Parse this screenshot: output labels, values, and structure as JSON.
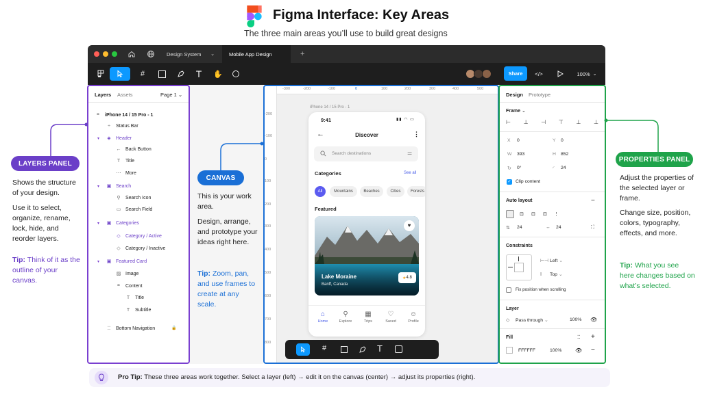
{
  "header": {
    "title": "Figma Interface: Key Areas",
    "subtitle": "The three main areas you’ll use to build great designs"
  },
  "tabs": {
    "design_system": "Design System",
    "mobile_app": "Mobile App Design",
    "new_tab": "+"
  },
  "toolbar": {
    "share": "Share",
    "zoom": "100%"
  },
  "layers_panel": {
    "tab_layers": "Layers",
    "tab_assets": "Assets",
    "page": "Page 1",
    "items": [
      {
        "label": "iPhone 14 / 15 Pro - 1"
      },
      {
        "label": "Status Bar"
      },
      {
        "label": "Header"
      },
      {
        "label": "Back Button"
      },
      {
        "label": "Title"
      },
      {
        "label": "More"
      },
      {
        "label": "Search"
      },
      {
        "label": "Search Icon"
      },
      {
        "label": "Search Field"
      },
      {
        "label": "Categories"
      },
      {
        "label": "Category / Active"
      },
      {
        "label": "Category / Inactive"
      },
      {
        "label": "Featured Card"
      },
      {
        "label": "Image"
      },
      {
        "label": "Content"
      },
      {
        "label": "Title"
      },
      {
        "label": "Subtitle"
      },
      {
        "label": "Bottom Navigation"
      }
    ]
  },
  "canvas": {
    "ruler_x": [
      "-300",
      "-200",
      "-100",
      "0",
      "100",
      "200",
      "300",
      "400",
      "500"
    ],
    "ruler_y": [
      "-200",
      "-100",
      "0",
      "100",
      "200",
      "300",
      "400",
      "500",
      "600",
      "700",
      "800"
    ],
    "frame_label": "iPhone 14 / 15 Pro - 1",
    "phone": {
      "time": "9:41",
      "screen_title": "Discover",
      "search_placeholder": "Search destinations",
      "categories_title": "Categories",
      "see_all": "See all",
      "chips": [
        "All",
        "Mountains",
        "Beaches",
        "Cities",
        "Forests"
      ],
      "featured_title": "Featured",
      "card_title": "Lake Moraine",
      "card_subtitle": "Banff, Canada",
      "rating": "4.8",
      "nav": [
        "Home",
        "Explore",
        "Trips",
        "Saved",
        "Profile"
      ]
    }
  },
  "props_panel": {
    "tab_design": "Design",
    "tab_prototype": "Prototype",
    "frame": "Frame",
    "x_label": "X",
    "x": "0",
    "y_label": "Y",
    "y": "0",
    "w_label": "W",
    "w": "393",
    "h_label": "H",
    "h": "852",
    "rotation": "0°",
    "radius": "24",
    "clip": "Clip content",
    "auto_layout": "Auto layout",
    "gap": "24",
    "padding": "24",
    "constraints": "Constraints",
    "left": "Left",
    "top": "Top",
    "fix_scroll": "Fix position when scrolling",
    "layer": "Layer",
    "blend": "Pass through",
    "opacity": "100%",
    "fill": "Fill",
    "fill_hex": "FFFFFF",
    "fill_opacity": "100%"
  },
  "callouts": {
    "layers": {
      "pill": "LAYERS PANEL",
      "d1": "Shows the structure of your design.",
      "d2": "Use it to select, organize, rename, lock, hide, and reorder layers.",
      "tip_label": "Tip:",
      "tip": "Think of it as the outline of your canvas."
    },
    "canvas": {
      "pill": "CANVAS",
      "d1": "This is your work area.",
      "d2": "Design, arrange, and prototype your ideas right here.",
      "tip_label": "Tip:",
      "tip": "Zoom, pan, and use frames to create at any scale."
    },
    "props": {
      "pill": "PROPERTIES PANEL",
      "d1": "Adjust the properties of the selected layer or frame.",
      "d2": "Change size, position, colors, typography, effects, and more.",
      "tip_label": "Tip:",
      "tip": "What you see here changes based on what’s selected."
    }
  },
  "protip": {
    "label": "Pro Tip:",
    "text": "These three areas work together. Select a layer (left) → edit it on the canvas (center) → adjust its properties (right)."
  },
  "colors": {
    "purple": "#6b3fc8",
    "blue": "#1a6fd6",
    "green": "#1fa34a",
    "accent": "#0d99ff"
  }
}
